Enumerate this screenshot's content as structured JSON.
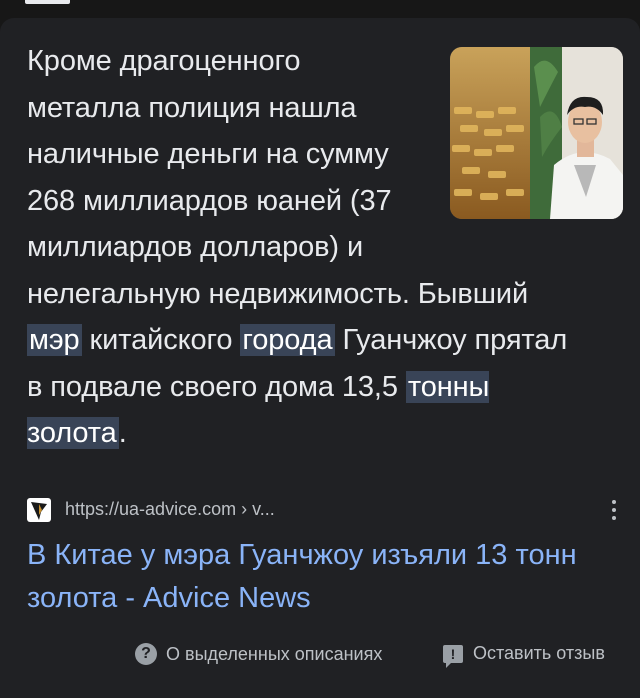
{
  "snippet": {
    "part1": "Кроме драгоценного металла полиция нашла наличные деньги на сумму 268 миллиардов юаней (37 миллиардов долларов) и нелегальную недвижимость. Бывший ",
    "hl1": "мэр",
    "part2": " китайского ",
    "hl2": "города",
    "part3": " Гуанчжоу прятал в подвале своего дома 13,5 ",
    "hl3": "тонны золота",
    "part4": "."
  },
  "source": {
    "url": "https://ua-advice.com › v..."
  },
  "result": {
    "title": "В Китае у мэра Гуанчжоу изъяли 13 тонн золота - Advice News"
  },
  "footer": {
    "about_label": "О выделенных описаниях",
    "feedback_label": "Оставить отзыв"
  },
  "colors": {
    "background": "#171717",
    "card": "#202124",
    "highlight": "#394457",
    "link": "#8ab4f8"
  },
  "icons": [
    "help-circle-icon",
    "feedback-icon",
    "more-vert-icon",
    "site-favicon"
  ]
}
